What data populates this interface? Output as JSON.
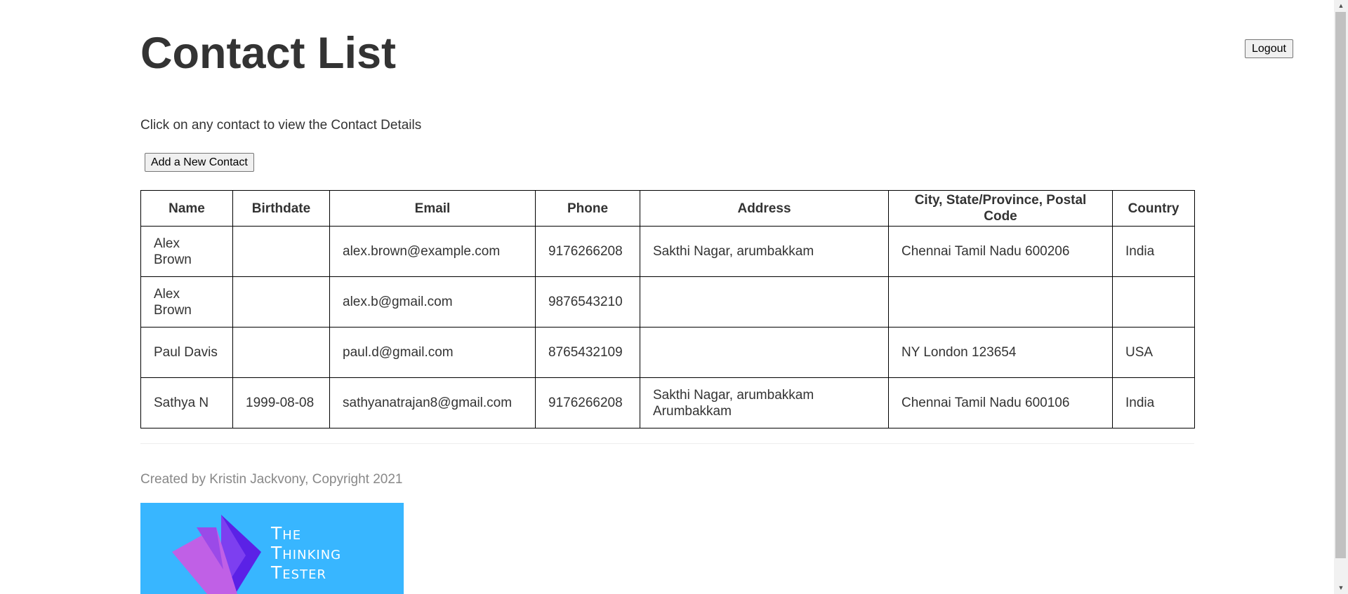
{
  "header": {
    "title": "Contact List",
    "logout_label": "Logout"
  },
  "instructions": "Click on any contact to view the Contact Details",
  "add_contact_label": "Add a New Contact",
  "table": {
    "columns": [
      "Name",
      "Birthdate",
      "Email",
      "Phone",
      "Address",
      "City, State/Province, Postal Code",
      "Country"
    ],
    "rows": [
      {
        "name": "Alex Brown",
        "birthdate": "",
        "email": "alex.brown@example.com",
        "phone": "9176266208",
        "address": "Sakthi Nagar, arumbakkam",
        "city": "Chennai Tamil Nadu 600206",
        "country": "India"
      },
      {
        "name": "Alex Brown",
        "birthdate": "",
        "email": "alex.b@gmail.com",
        "phone": "9876543210",
        "address": "",
        "city": "",
        "country": ""
      },
      {
        "name": "Paul Davis",
        "birthdate": "",
        "email": "paul.d@gmail.com",
        "phone": "8765432109",
        "address": "",
        "city": "NY London 123654",
        "country": "USA"
      },
      {
        "name": "Sathya N",
        "birthdate": "1999-08-08",
        "email": "sathyanatrajan8@gmail.com",
        "phone": "9176266208",
        "address": "Sakthi Nagar, arumbakkam Arumbakkam",
        "city": "Chennai Tamil Nadu 600106",
        "country": "India"
      }
    ]
  },
  "footer": {
    "credit": "Created by Kristin Jackvony, Copyright 2021",
    "logo_text": [
      "The",
      "Thinking",
      "Tester"
    ]
  },
  "colors": {
    "text": "#333333",
    "footer_text": "#888888",
    "logo_bg": "#38b6ff",
    "logo_purple_dark": "#5b21e6",
    "logo_purple_light": "#c060e6"
  },
  "icons": {
    "logo": "thinking-tester-logo-icon",
    "scroll_up": "scroll-up-arrow-icon",
    "scroll_down": "scroll-down-arrow-icon"
  }
}
